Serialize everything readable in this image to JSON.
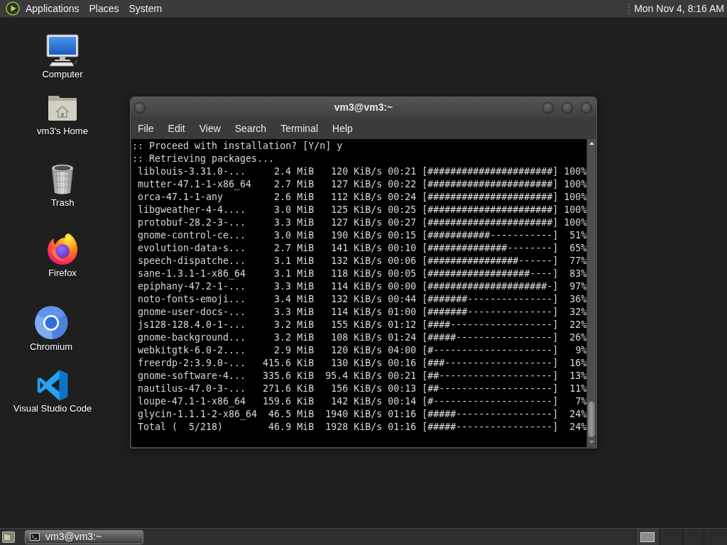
{
  "top_panel": {
    "menus": [
      "Applications",
      "Places",
      "System"
    ],
    "clock": "Mon Nov 4, 8:16 AM"
  },
  "desktop_icons": [
    {
      "label": "Computer",
      "kind": "computer"
    },
    {
      "label": "vm3's Home",
      "kind": "home"
    },
    {
      "label": "Trash",
      "kind": "trash"
    },
    {
      "label": "Firefox",
      "kind": "firefox"
    },
    {
      "label": "Chromium",
      "kind": "chromium"
    },
    {
      "label": "Visual Studio Code",
      "kind": "vscode"
    }
  ],
  "terminal": {
    "title": "vm3@vm3:~",
    "menu": [
      "File",
      "Edit",
      "View",
      "Search",
      "Terminal",
      "Help"
    ],
    "prompt_lines": [
      ":: Proceed with installation? [Y/n] y",
      ":: Retrieving packages..."
    ],
    "downloads": [
      {
        "package": "liblouis-3.31.0-...",
        "size": "2.4 MiB",
        "rate": "120 KiB/s",
        "eta": "00:21",
        "bar": "[######################]",
        "percent": "100%"
      },
      {
        "package": "mutter-47.1-1-x86_64",
        "size": "2.7 MiB",
        "rate": "127 KiB/s",
        "eta": "00:22",
        "bar": "[######################]",
        "percent": "100%"
      },
      {
        "package": "orca-47.1-1-any",
        "size": "2.6 MiB",
        "rate": "112 KiB/s",
        "eta": "00:24",
        "bar": "[######################]",
        "percent": "100%"
      },
      {
        "package": "libgweather-4-4....",
        "size": "3.0 MiB",
        "rate": "125 KiB/s",
        "eta": "00:25",
        "bar": "[######################]",
        "percent": "100%"
      },
      {
        "package": "protobuf-28.2-3-...",
        "size": "3.3 MiB",
        "rate": "127 KiB/s",
        "eta": "00:27",
        "bar": "[######################]",
        "percent": "100%"
      },
      {
        "package": "gnome-control-ce...",
        "size": "3.0 MiB",
        "rate": "190 KiB/s",
        "eta": "00:15",
        "bar": "[###########-----------]",
        "percent": "51%"
      },
      {
        "package": "evolution-data-s...",
        "size": "2.7 MiB",
        "rate": "141 KiB/s",
        "eta": "00:10",
        "bar": "[##############--------]",
        "percent": "65%"
      },
      {
        "package": "speech-dispatche...",
        "size": "3.1 MiB",
        "rate": "132 KiB/s",
        "eta": "00:06",
        "bar": "[################------]",
        "percent": "77%"
      },
      {
        "package": "sane-1.3.1-1-x86_64",
        "size": "3.1 MiB",
        "rate": "118 KiB/s",
        "eta": "00:05",
        "bar": "[##################----]",
        "percent": "83%"
      },
      {
        "package": "epiphany-47.2-1-...",
        "size": "3.3 MiB",
        "rate": "114 KiB/s",
        "eta": "00:00",
        "bar": "[#####################-]",
        "percent": "97%"
      },
      {
        "package": "noto-fonts-emoji...",
        "size": "3.4 MiB",
        "rate": "132 KiB/s",
        "eta": "00:44",
        "bar": "[#######---------------]",
        "percent": "36%"
      },
      {
        "package": "gnome-user-docs-...",
        "size": "3.3 MiB",
        "rate": "114 KiB/s",
        "eta": "01:00",
        "bar": "[#######---------------]",
        "percent": "32%"
      },
      {
        "package": "js128-128.4.0-1-...",
        "size": "3.2 MiB",
        "rate": "155 KiB/s",
        "eta": "01:12",
        "bar": "[####------------------]",
        "percent": "22%"
      },
      {
        "package": "gnome-background...",
        "size": "3.2 MiB",
        "rate": "108 KiB/s",
        "eta": "01:24",
        "bar": "[#####-----------------]",
        "percent": "26%"
      },
      {
        "package": "webkitgtk-6.0-2....",
        "size": "2.9 MiB",
        "rate": "120 KiB/s",
        "eta": "04:00",
        "bar": "[#---------------------]",
        "percent": "9%"
      },
      {
        "package": "freerdp-2:3.9.0-...",
        "size": "415.6 KiB",
        "rate": "130 KiB/s",
        "eta": "00:16",
        "bar": "[###-------------------]",
        "percent": "16%"
      },
      {
        "package": "gnome-software-4...",
        "size": "335.6 KiB",
        "rate": "95.4 KiB/s",
        "eta": "00:21",
        "bar": "[##--------------------]",
        "percent": "13%"
      },
      {
        "package": "nautilus-47.0-3-...",
        "size": "271.6 KiB",
        "rate": "156 KiB/s",
        "eta": "00:13",
        "bar": "[##--------------------]",
        "percent": "11%"
      },
      {
        "package": "loupe-47.1-1-x86_64",
        "size": "159.6 KiB",
        "rate": "142 KiB/s",
        "eta": "00:14",
        "bar": "[#---------------------]",
        "percent": "7%"
      },
      {
        "package": "glycin-1.1.1-2-x86_64",
        "size": "46.5 MiB",
        "rate": "1940 KiB/s",
        "eta": "01:16",
        "bar": "[#####-----------------]",
        "percent": "24%"
      },
      {
        "package": "Total (  5/218)",
        "size": "46.9 MiB",
        "rate": "1928 KiB/s",
        "eta": "01:16",
        "bar": "[#####-----------------]",
        "percent": "24%"
      }
    ]
  },
  "taskbar": {
    "tasks": [
      {
        "label": "vm3@vm3:~",
        "selected": true
      }
    ]
  }
}
